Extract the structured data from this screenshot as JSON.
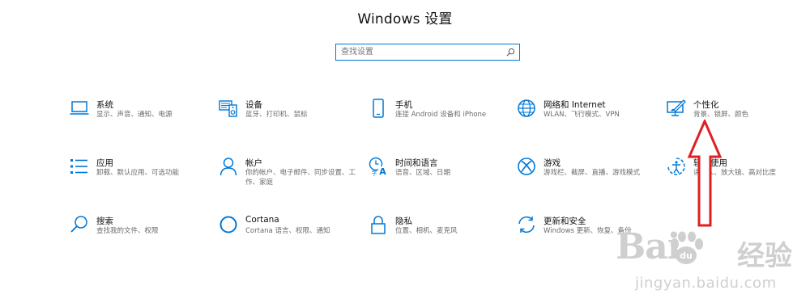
{
  "window": {
    "title": "Windows 设置"
  },
  "search": {
    "placeholder": "查找设置"
  },
  "colors": {
    "accent": "#0078d7",
    "arrow": "#e02020"
  },
  "tiles": [
    {
      "name": "系统",
      "desc": "显示、声音、通知、电源",
      "icon": "laptop-icon"
    },
    {
      "name": "设备",
      "desc": "蓝牙、打印机、鼠标",
      "icon": "devices-icon"
    },
    {
      "name": "手机",
      "desc": "连接 Android 设备和 iPhone",
      "icon": "phone-icon"
    },
    {
      "name": "网络和 Internet",
      "desc": "WLAN、飞行模式、VPN",
      "icon": "globe-icon"
    },
    {
      "name": "个性化",
      "desc": "背景、锁屏、颜色",
      "icon": "personalization-icon"
    },
    {
      "name": "应用",
      "desc": "卸载、默认应用、可选功能",
      "icon": "apps-list-icon"
    },
    {
      "name": "帐户",
      "desc": "你的帐户、电子邮件、同步设置、工作、家庭",
      "icon": "person-icon"
    },
    {
      "name": "时间和语言",
      "desc": "语音、区域、日期",
      "icon": "time-language-icon"
    },
    {
      "name": "游戏",
      "desc": "游戏栏、截屏、直播、游戏模式",
      "icon": "xbox-icon"
    },
    {
      "name": "轻松使用",
      "desc": "讲述人、放大镜、高对比度",
      "icon": "ease-of-access-icon"
    },
    {
      "name": "搜索",
      "desc": "查找我的文件、权限",
      "icon": "search-icon"
    },
    {
      "name": "Cortana",
      "desc": "Cortana 语言、权限、通知",
      "icon": "cortana-ring-icon"
    },
    {
      "name": "隐私",
      "desc": "位置、相机、麦克风",
      "icon": "lock-icon"
    },
    {
      "name": "更新和安全",
      "desc": "Windows 更新、恢复、备份",
      "icon": "sync-arrows-icon"
    }
  ],
  "watermark": {
    "brand": "Bai",
    "brand_cn": "经验",
    "url": "jingyan.baidu.com"
  }
}
